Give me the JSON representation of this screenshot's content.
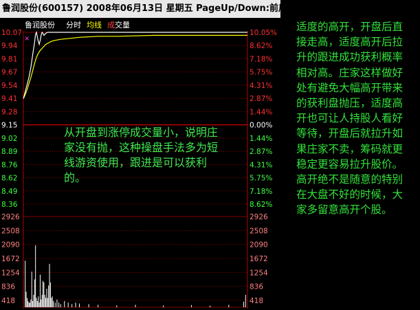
{
  "window": {
    "title": "鲁润股份(600157) 2008年06月13日 星期五 PageUp/Down:前后"
  },
  "legend": {
    "name": "鲁润股份",
    "items": [
      {
        "label": "分时",
        "color": "#ffffff"
      },
      {
        "label": "均线",
        "color": "#ffff00"
      },
      {
        "label": "成",
        "color": "#ff4040"
      },
      {
        "label": "交量",
        "color": "#ffffff"
      }
    ]
  },
  "colors": {
    "price_line": "#ffffff",
    "avg_line": "#ffff00",
    "up_label": "#ff3030",
    "down_label": "#40ff40",
    "grid": "#b00000",
    "volume": "#ffffff",
    "annotation": "#40e850"
  },
  "chart_data": {
    "type": "line",
    "price_axis": {
      "prev_close": 9.15,
      "ylim": [
        8.36,
        10.07
      ],
      "left_ticks": [
        "10.07",
        "9.94",
        "9.81",
        "9.67",
        "9.54",
        "9.41",
        "9.28",
        "9.15",
        "9.02",
        "8.89",
        "8.76",
        "8.62",
        "8.49",
        "8.36"
      ],
      "right_ticks": [
        "10.05%",
        "8.62%",
        "7.18%",
        "5.75%",
        "4.31%",
        "2.87%",
        "1.44%",
        "0.00%",
        "1.44%",
        "2.87%",
        "4.31%",
        "5.75%",
        "7.18%",
        "8.62%"
      ]
    },
    "series": [
      {
        "name": "分时",
        "x": [
          0,
          2,
          4,
          6,
          8,
          10,
          12,
          13,
          14,
          15,
          16,
          17,
          18,
          19,
          20,
          21,
          22,
          24,
          26,
          28,
          30,
          34,
          40,
          50,
          60,
          80,
          100,
          140,
          180,
          200,
          240
        ],
        "y": [
          9.41,
          9.48,
          9.55,
          9.62,
          9.72,
          9.85,
          9.97,
          10.05,
          10.07,
          10.02,
          9.98,
          9.95,
          9.99,
          10.04,
          10.07,
          10.06,
          10.04,
          10.06,
          10.07,
          10.07,
          10.07,
          10.07,
          10.07,
          10.07,
          10.07,
          10.07,
          10.07,
          10.07,
          10.07,
          10.07,
          10.07
        ]
      },
      {
        "name": "均线",
        "x": [
          0,
          2,
          4,
          6,
          8,
          10,
          12,
          14,
          16,
          18,
          20,
          22,
          24,
          26,
          28,
          30,
          34,
          40,
          50,
          60,
          80,
          100,
          140,
          180,
          200,
          240
        ],
        "y": [
          9.41,
          9.45,
          9.5,
          9.56,
          9.62,
          9.69,
          9.76,
          9.82,
          9.86,
          9.89,
          9.91,
          9.93,
          9.95,
          9.96,
          9.97,
          9.98,
          9.99,
          10.0,
          10.01,
          10.02,
          10.03,
          10.03,
          10.04,
          10.04,
          10.04,
          10.04
        ]
      }
    ],
    "volume_axis": {
      "ylim": [
        0,
        2926
      ],
      "ticks": [
        "2926",
        "2508",
        "2090",
        "1672",
        "1254",
        "836",
        "418"
      ]
    },
    "volume": {
      "x": [
        2,
        3,
        4,
        5,
        6,
        7,
        8,
        9,
        10,
        11,
        12,
        13,
        14,
        15,
        16,
        17,
        18,
        19,
        20,
        21,
        22,
        23,
        24,
        25,
        26,
        27,
        28,
        29,
        30,
        31,
        32,
        34,
        36,
        38,
        40,
        44,
        48,
        52,
        56,
        60,
        70,
        80,
        100,
        120,
        150,
        180,
        200,
        220,
        236,
        238
      ],
      "values": [
        1500,
        500,
        300,
        200,
        150,
        150,
        250,
        1150,
        200,
        400,
        900,
        2000,
        300,
        200,
        350,
        150,
        1050,
        250,
        400,
        850,
        800,
        400,
        300,
        600,
        300,
        700,
        1400,
        800,
        300,
        350,
        200,
        150,
        250,
        150,
        100,
        200,
        150,
        100,
        150,
        120,
        100,
        80,
        60,
        80,
        60,
        70,
        50,
        80,
        180,
        400
      ]
    }
  },
  "annotations": {
    "left": "从开盘到涨停成交量小，说明庄家没有抛，这种操盘手法多为短线游资使用，跟进是可以获利的。",
    "right": "适度的高开，开盘后直接走高，适度高开后拉升的跟进成功获利概率相对高。庄家这样做好处有避免大幅高开带来的获利盘抛压，适度高开也可让人持股人看好等待，开盘后就拉升如果庄家不卖，筹码就更稳定更容易拉升股价。高开绝不是随意的特别在大盘不好的时候，大家多留意高开个股。"
  }
}
